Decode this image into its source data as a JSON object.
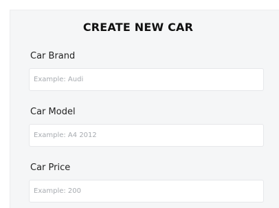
{
  "form": {
    "title": "CREATE NEW CAR",
    "fields": [
      {
        "label": "Car Brand",
        "value": "",
        "placeholder": "Example: Audi"
      },
      {
        "label": "Car Model",
        "value": "",
        "placeholder": "Example: A4 2012"
      },
      {
        "label": "Car Price",
        "value": "",
        "placeholder": "Example: 200"
      }
    ]
  },
  "colors": {
    "card_background": "#f5f6f7",
    "input_border": "#e6e7ea",
    "placeholder": "#a7abb0",
    "title_text": "#111111"
  }
}
